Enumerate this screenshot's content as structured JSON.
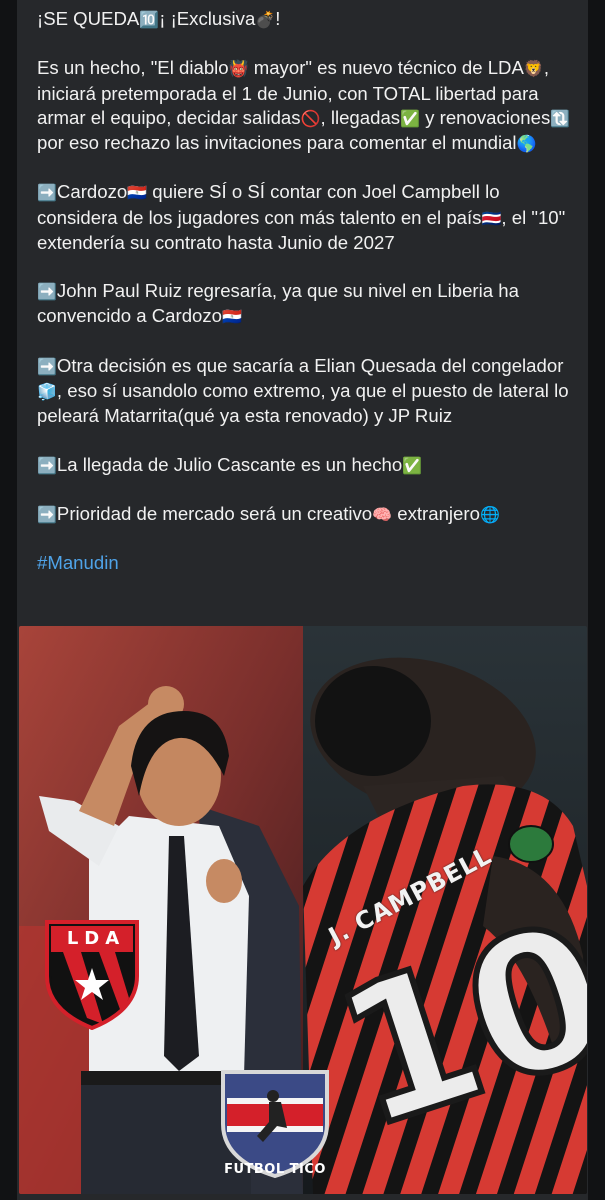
{
  "post": {
    "paragraphs": [
      {
        "segments": [
          {
            "t": "¡SE QUEDA"
          },
          {
            "e": "🔟"
          },
          {
            "t": "¡ ¡Exclusiva"
          },
          {
            "e": "💣"
          },
          {
            "t": "!"
          }
        ]
      },
      {
        "segments": [
          {
            "t": "Es un hecho, \"El diablo"
          },
          {
            "e": "👹"
          },
          {
            "t": " mayor\" es nuevo técnico de LDA"
          },
          {
            "e": "🦁"
          },
          {
            "t": ", iniciará pretemporada el 1 de Junio, con TOTAL libertad para armar el equipo, decidar salidas"
          },
          {
            "e": "🚫"
          },
          {
            "t": ", llegadas"
          },
          {
            "e": "✅"
          },
          {
            "t": " y renovaciones"
          },
          {
            "e": "🔃"
          },
          {
            "t": " por eso rechazo las invitaciones para comentar el mundial"
          },
          {
            "e": "🌎"
          }
        ]
      },
      {
        "segments": [
          {
            "e": "➡️"
          },
          {
            "t": "Cardozo"
          },
          {
            "e": "🇵🇾"
          },
          {
            "t": " quiere SÍ  o SÍ contar con Joel Campbell lo considera de los jugadores con más talento en el país"
          },
          {
            "e": "🇨🇷"
          },
          {
            "t": ", el \"10\" extendería su contrato hasta Junio de 2027"
          }
        ]
      },
      {
        "segments": [
          {
            "e": "➡️"
          },
          {
            "t": "John Paul Ruiz regresaría, ya que su nivel en Liberia ha convencido a Cardozo"
          },
          {
            "e": "🇵🇾"
          }
        ]
      },
      {
        "segments": [
          {
            "e": "➡️"
          },
          {
            "t": "Otra decisión es que sacaría a Elian Quesada del congelador"
          },
          {
            "e": "🧊"
          },
          {
            "t": ", eso sí usandolo como extremo, ya que el puesto de lateral lo peleará Matarrita(qué ya esta renovado) y JP Ruiz"
          }
        ]
      },
      {
        "segments": [
          {
            "e": "➡️"
          },
          {
            "t": "La llegada de Julio Cascante es un hecho"
          },
          {
            "e": "✅"
          }
        ]
      },
      {
        "segments": [
          {
            "e": "➡️"
          },
          {
            "t": "Prioridad de mercado será un creativo"
          },
          {
            "e": "🧠"
          },
          {
            "t": " extranjero"
          },
          {
            "e": "🌐"
          }
        ]
      }
    ],
    "hashtag": "#Manudin"
  },
  "image": {
    "logo_left": "LDA",
    "watermark": "FUTBOL TICO",
    "shirt_name": "J. CAMPBELL",
    "shirt_number": "10"
  },
  "colors": {
    "bubble": "#26282b",
    "background": "#111214",
    "text": "#f1f1f1",
    "link": "#4fa3e8",
    "lda_red": "#d4202a"
  }
}
